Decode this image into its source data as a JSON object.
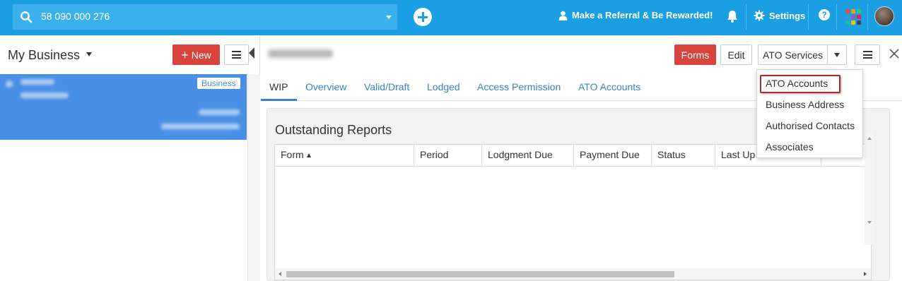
{
  "topbar": {
    "search_value": "58 090 000 276",
    "referral_label": "Make a Referral & Be Rewarded!",
    "settings_label": "Settings",
    "help_label": "?",
    "apps_colors": [
      "#e74c3c",
      "#f39c12",
      "#2ecc71",
      "#3498db",
      "#9b59b6",
      "#e91e63",
      "#1abc9c",
      "#f1c40f",
      "#34495e"
    ]
  },
  "left": {
    "title": "My Business",
    "new_label": "New",
    "business_badge": "Business"
  },
  "right": {
    "buttons": {
      "forms": "Forms",
      "edit": "Edit",
      "ato_services": "ATO Services"
    },
    "tabs": [
      {
        "label": "WIP"
      },
      {
        "label": "Overview"
      },
      {
        "label": "Valid/Draft"
      },
      {
        "label": "Lodged"
      },
      {
        "label": "Access Permission"
      },
      {
        "label": "ATO Accounts"
      }
    ],
    "panel_title": "Outstanding Reports",
    "columns": [
      "Form",
      "Period",
      "Lodgment Due",
      "Payment Due",
      "Status",
      "Last Up"
    ]
  },
  "dropdown": {
    "items": [
      "ATO Accounts",
      "Business Address",
      "Authorised Contacts",
      "Associates"
    ]
  },
  "colors": {
    "topbar": "#1a9fe3",
    "accent_red": "#d9433e",
    "selected_row": "#4a8fe6",
    "link": "#3b82c4"
  }
}
